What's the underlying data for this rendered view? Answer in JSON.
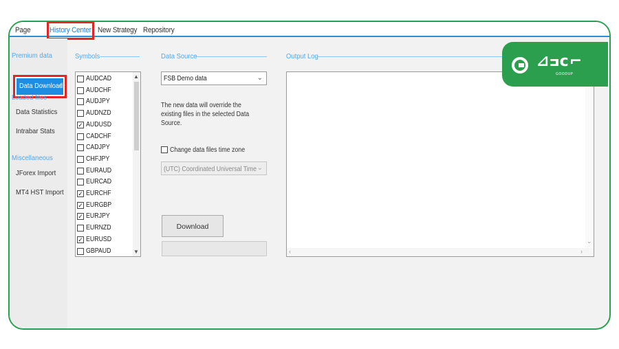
{
  "tabs": [
    {
      "label": "Page",
      "active": false
    },
    {
      "label": "History Center",
      "active": true
    },
    {
      "label": "New Strategy",
      "active": false
    },
    {
      "label": "Repository",
      "active": false
    }
  ],
  "sidebar": {
    "premium_header": "Premium data",
    "selected_item": "Data Download",
    "loaded_header": "Loaded files",
    "loaded_items": [
      "Data Statistics",
      "Intrabar Stats"
    ],
    "misc_header": "Miscellaneous",
    "misc_items": [
      "JForex Import",
      "MT4 HST Import"
    ]
  },
  "symbols": {
    "title": "Symbols",
    "items": [
      {
        "label": "AUDCAD",
        "checked": false
      },
      {
        "label": "AUDCHF",
        "checked": false
      },
      {
        "label": "AUDJPY",
        "checked": false
      },
      {
        "label": "AUDNZD",
        "checked": false
      },
      {
        "label": "AUDUSD",
        "checked": true
      },
      {
        "label": "CADCHF",
        "checked": false
      },
      {
        "label": "CADJPY",
        "checked": false
      },
      {
        "label": "CHFJPY",
        "checked": false
      },
      {
        "label": "EURAUD",
        "checked": false
      },
      {
        "label": "EURCAD",
        "checked": false
      },
      {
        "label": "EURCHF",
        "checked": true
      },
      {
        "label": "EURGBP",
        "checked": true
      },
      {
        "label": "EURJPY",
        "checked": true
      },
      {
        "label": "EURNZD",
        "checked": false
      },
      {
        "label": "EURUSD",
        "checked": true
      },
      {
        "label": "GBPAUD",
        "checked": false
      }
    ]
  },
  "data_source": {
    "title": "Data Source",
    "selected": "FSB Demo data",
    "note": "The new data will override the existing files in the selected Data Source.",
    "tz_checkbox_label": "Change data files time zone",
    "tz_checked": false,
    "tz_selected": "(UTC) Coordinated Universal Time",
    "download_label": "Download"
  },
  "output_log": {
    "title": "Output Log"
  },
  "logo": {
    "icon": "goodup-logo-icon",
    "sub_text": "GOODUP"
  },
  "colors": {
    "frame_border": "#27a04f",
    "highlight": "#e32424",
    "accent_blue": "#1e8ce0",
    "section_title": "#56a8e8"
  }
}
